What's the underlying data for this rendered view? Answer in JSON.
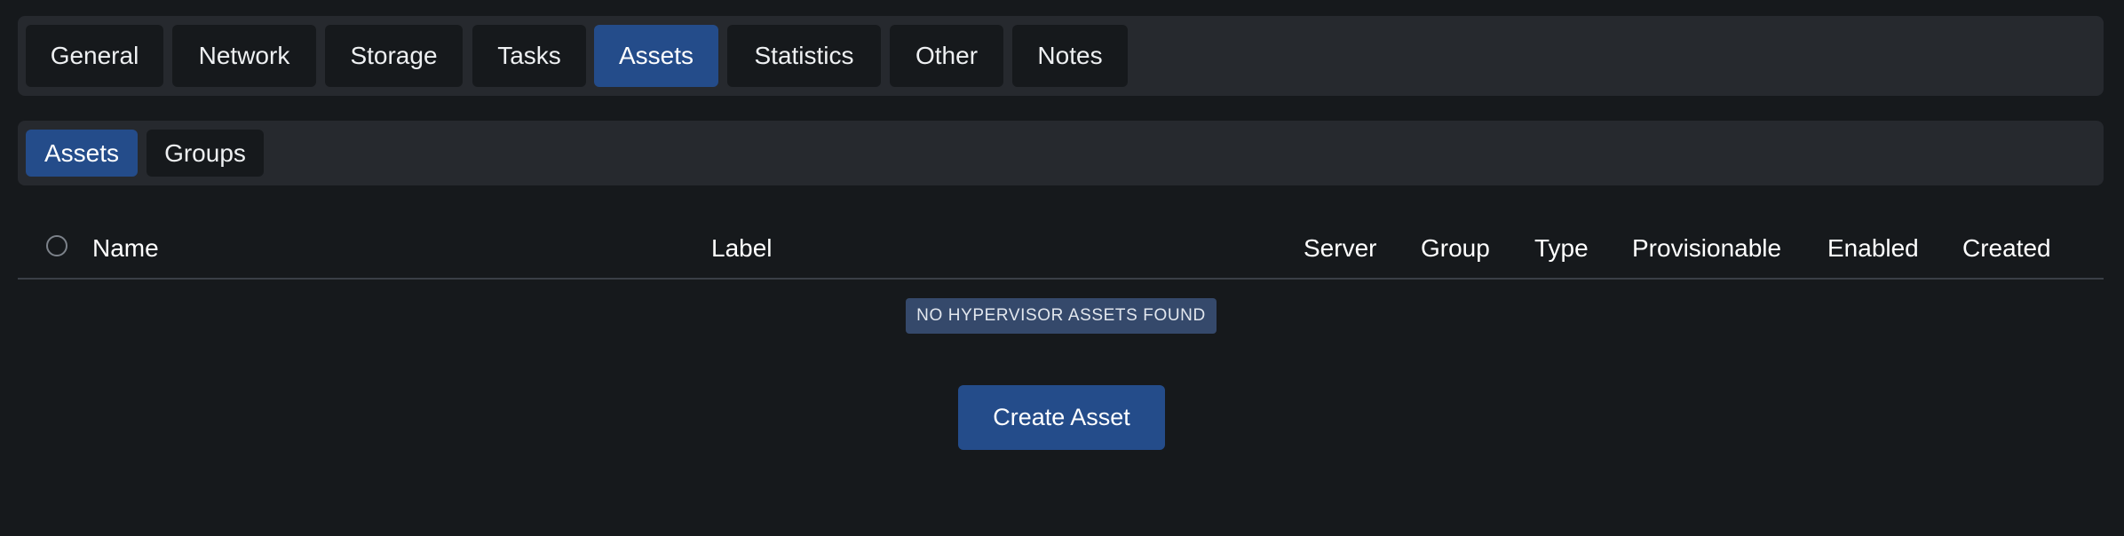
{
  "main_tabs": [
    {
      "label": "General",
      "active": false
    },
    {
      "label": "Network",
      "active": false
    },
    {
      "label": "Storage",
      "active": false
    },
    {
      "label": "Tasks",
      "active": false
    },
    {
      "label": "Assets",
      "active": true
    },
    {
      "label": "Statistics",
      "active": false
    },
    {
      "label": "Other",
      "active": false
    },
    {
      "label": "Notes",
      "active": false
    }
  ],
  "sub_tabs": [
    {
      "label": "Assets",
      "active": true
    },
    {
      "label": "Groups",
      "active": false
    }
  ],
  "table": {
    "select_all_icon": "circle-checkbox-icon",
    "columns": [
      "Name",
      "Label",
      "Server",
      "Group",
      "Type",
      "Provisionable",
      "Enabled",
      "Created"
    ],
    "empty_message": "NO HYPERVISOR ASSETS FOUND"
  },
  "actions": {
    "create_label": "Create Asset"
  },
  "colors": {
    "background": "#16191c",
    "bar": "#26292e",
    "accent": "#244c8a",
    "badge": "#35496b"
  }
}
